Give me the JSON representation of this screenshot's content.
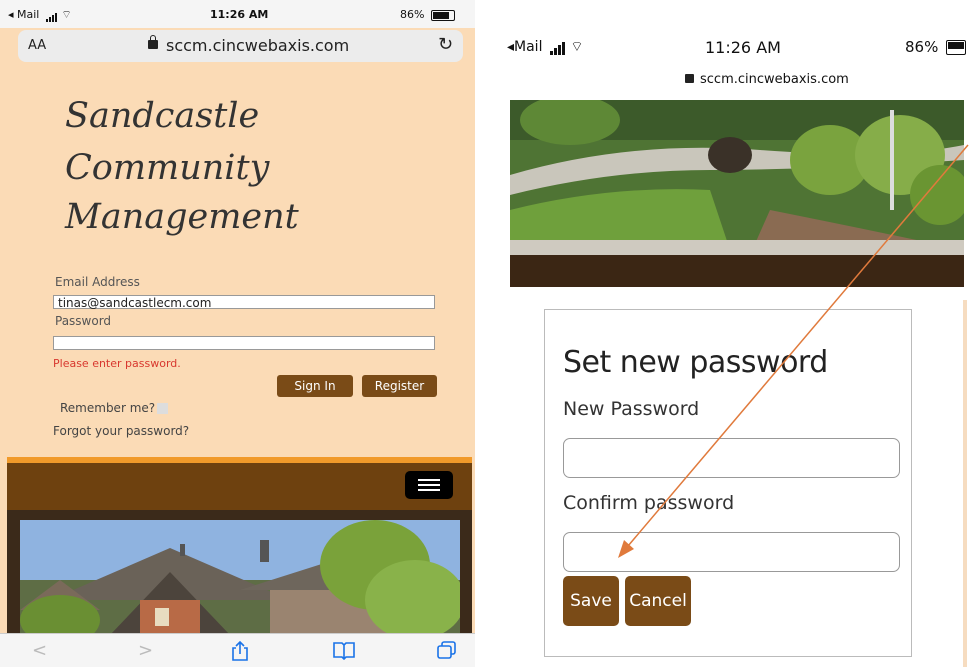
{
  "left": {
    "status": {
      "carrier": "◂ Mail",
      "time": "11:26 AM",
      "battery": "86%"
    },
    "url": {
      "aa": "AA",
      "host": "sccm.cincwebaxis.com",
      "reload_icon": "↻"
    },
    "brand": {
      "line1": "Sandcastle",
      "line2": "Community",
      "line3": "Management"
    },
    "login": {
      "email_label": "Email Address",
      "email_value": "tinas@sandcastlecm.com",
      "password_label": "Password",
      "password_value": "",
      "error": "Please enter password.",
      "sign_in": "Sign In",
      "register": "Register",
      "remember": "Remember me?",
      "forgot": "Forgot your password?"
    },
    "toolbar": {
      "back": "<",
      "forward": ">",
      "share_icon": "share-icon",
      "bookmarks_icon": "book-icon",
      "tabs_icon": "tabs-icon"
    }
  },
  "right": {
    "status": {
      "carrier": "◂Mail",
      "time": "11:26 AM",
      "battery": "86%",
      "host": "sccm.cincwebaxis.com"
    },
    "form": {
      "title": "Set new password",
      "new_label": "New Password",
      "confirm_label": "Confirm password",
      "save": "Save",
      "cancel": "Cancel"
    }
  },
  "colors": {
    "brand_brown": "#7a4b17",
    "page_bg": "#fbdbb6",
    "accent_orange": "#f19a2a",
    "error_red": "#d8382f",
    "annotation": "#e07a3c"
  }
}
